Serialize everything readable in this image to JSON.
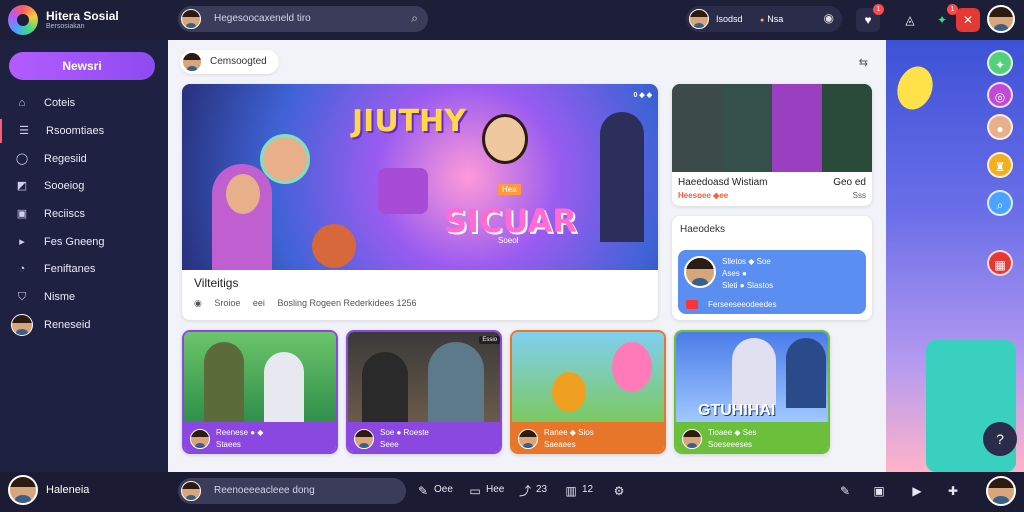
{
  "app": {
    "title": "Hitera Sosial",
    "subtitle": "Bersosiakan"
  },
  "search": {
    "placeholder": "Hegesoocaxeneld tiro"
  },
  "profile_pill": {
    "name": "Isodsd",
    "status": "Nsa"
  },
  "sidebar": {
    "new_button": "Newsri",
    "items": [
      {
        "label": "Coteis",
        "icon": "home-icon"
      },
      {
        "label": "Rsoomtiaes",
        "icon": "people-icon"
      },
      {
        "label": "Regesiid",
        "icon": "chat-icon"
      },
      {
        "label": "Sooeiog",
        "icon": "flag-icon"
      },
      {
        "label": "Reciiscs",
        "icon": "grid-icon"
      },
      {
        "label": "Fes Gneeng",
        "icon": "video-icon"
      },
      {
        "label": "Feniftanes",
        "icon": "clock-icon"
      },
      {
        "label": "Nisme",
        "icon": "bookmark-icon"
      },
      {
        "label": "Reneseid",
        "icon": "avatar"
      }
    ]
  },
  "feed": {
    "chip_label": "Cemsoogted",
    "hero": {
      "tag": "0 ◆ ◆",
      "big_text": "JIUTHY",
      "big_text_2": "SICUAR",
      "small_text": "Hea",
      "small_text_2": "Soeol",
      "title": "Vilteitigs",
      "meta": [
        "Sroioe",
        "eei",
        "Bosling Rogeen Rederkidees 1256"
      ]
    },
    "side_card": {
      "title_left": "Haeedoasd Wistiam",
      "title_right": "Geo ed",
      "meta_left": "Heesoee ◆ee",
      "meta_right": "Sss"
    },
    "side_card_2": {
      "header": "Haeodeks",
      "lines": [
        "Slletos ◆ Soe",
        "Ases ●",
        "Sleti ● Slastos",
        "Ferseeseeodeedes"
      ]
    },
    "cards": [
      {
        "line1": "Reenese ● ◆",
        "line2": "Staees",
        "tag": ""
      },
      {
        "line1": "Soe ● Roeste",
        "line2": "Seee",
        "tag": "Essio"
      },
      {
        "line1": "Ranee ◆ Sios",
        "line2": "Saeaees",
        "tag": ""
      },
      {
        "line1": "Tioaee ◆ Ses",
        "line2": "Soeseeeses",
        "tag": "",
        "big_text": "GTUHIHAI"
      }
    ]
  },
  "bottom": {
    "user_name": "Haleneia",
    "compose_placeholder": "Reenoeeeacleee dong",
    "items": [
      "Oee",
      "Hee",
      "23",
      "12"
    ]
  },
  "colors": {
    "accent": "#a957f7",
    "topbar": "#1d1f38",
    "sidebar": "#1f2140",
    "main_bg": "#f2f3f8",
    "notify": "#ff4a4a"
  }
}
